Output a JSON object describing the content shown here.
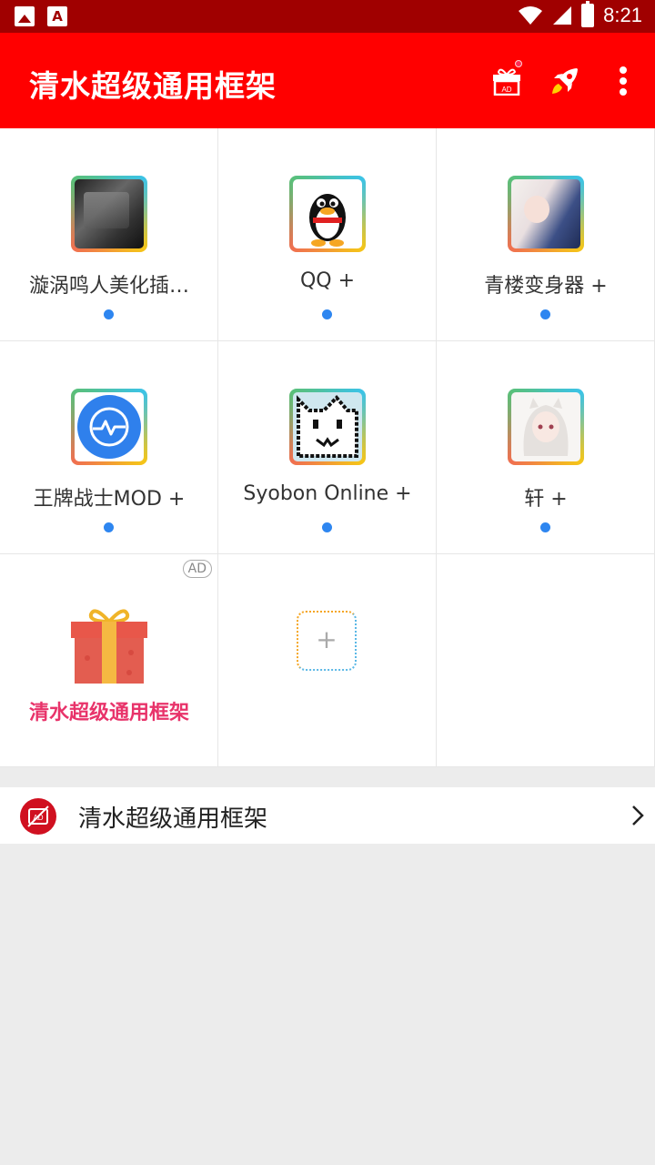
{
  "status_bar": {
    "time": "8:21",
    "notif_a": "A"
  },
  "appbar": {
    "title": "清水超级通用框架",
    "ad_icon_text": "AD"
  },
  "apps": [
    {
      "label": "漩涡鸣人美化插…"
    },
    {
      "label": "QQ +"
    },
    {
      "label": "青楼变身器 +"
    },
    {
      "label": "王牌战士MOD +"
    },
    {
      "label": "Syobon Online +"
    },
    {
      "label": "轩 +"
    }
  ],
  "promo": {
    "badge": "AD",
    "label": "清水超级通用框架"
  },
  "add_tile": {
    "symbol": "+"
  },
  "list_row": {
    "label": "清水超级通用框架",
    "icon_text": "AD"
  }
}
